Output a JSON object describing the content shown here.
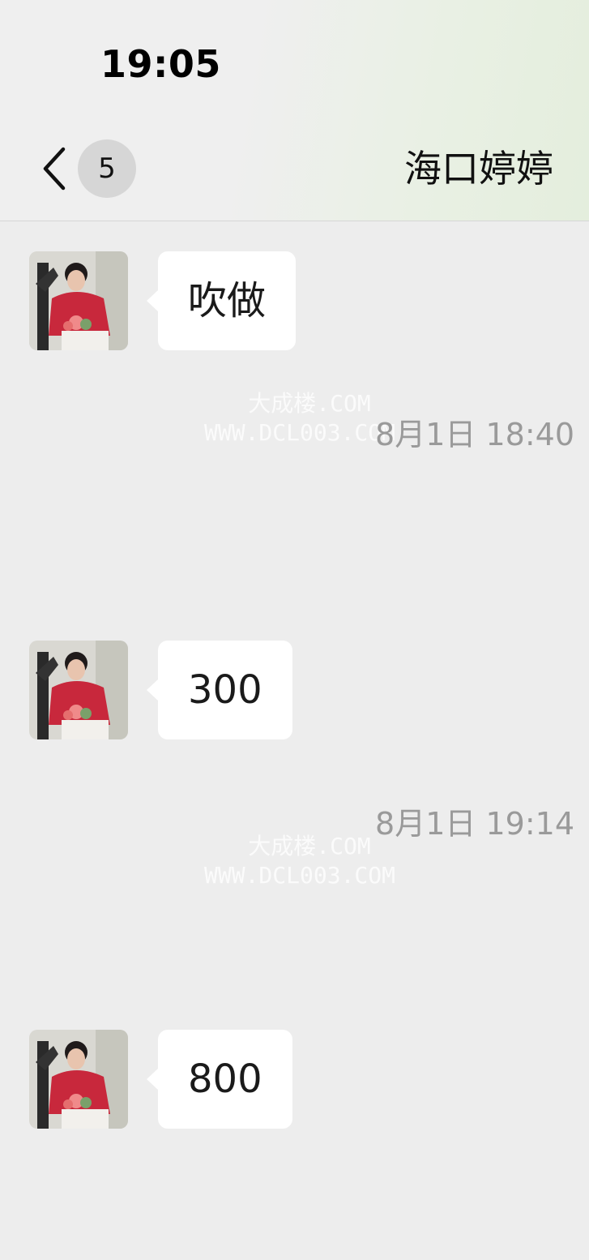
{
  "status_bar": {
    "time": "19:05"
  },
  "header": {
    "unread_count": "5",
    "title": "海口婷婷"
  },
  "watermark": {
    "line1": "大成楼.COM",
    "line2": "WWW.DCL003.COM"
  },
  "messages": [
    {
      "text": "吹做"
    },
    {
      "timestamp": "8月1日 18:40"
    },
    {
      "text": "300"
    },
    {
      "timestamp": "8月1日 19:14"
    },
    {
      "text": "800"
    }
  ],
  "colors": {
    "background": "#ededed",
    "bubble": "#ffffff",
    "timestamp": "#9a9a9a",
    "badge": "#d6d6d6",
    "avatar_dress": "#c8283c"
  }
}
